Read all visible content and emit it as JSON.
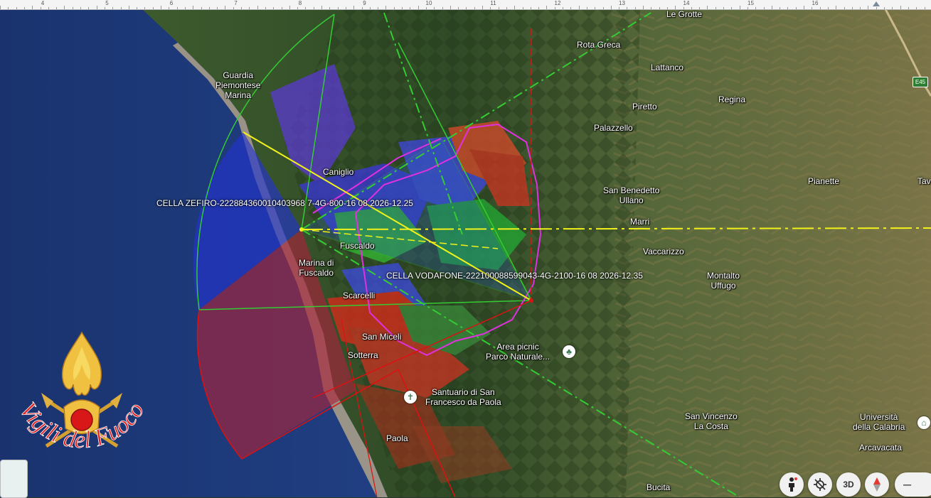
{
  "ruler": {
    "numbers": [
      "4",
      "5",
      "6",
      "7",
      "8",
      "9",
      "10",
      "11",
      "12",
      "13",
      "14",
      "15",
      "16"
    ]
  },
  "cells": {
    "zefiro": "CELLA ZEFIRO-222884360010403968 7-4G-800-16 08 2026-12.25",
    "vodafone": "CELLA VODAFONE-222100088599043-4G-2100-16 08 2026-12.35"
  },
  "places": {
    "le_grotte": "Le Grotte",
    "rota_greca": "Rota Greca",
    "lattanco": "Lattanco",
    "regina": "Regina",
    "guardia": "Guardia\nPiemontese\nMarina",
    "piretto": "Piretto",
    "palazzello": "Palazzello",
    "caniglio": "Caniglio",
    "san_benedetto": "San Benedetto\nUllano",
    "pianette": "Pianette",
    "tav": "Tav",
    "marri": "Marri",
    "fuscaldo": "Fuscaldo",
    "marina_fuscaldo": "Marina di\nFuscaldo",
    "vaccarizzo": "Vaccarizzo",
    "montalto": "Montalto\nUffugo",
    "scarcelli": "Scarcelli",
    "san_miceli": "San Miceli",
    "sotterra": "Sotterra",
    "area_picnic": "Area picnic\nParco Naturale...",
    "santuario": "Santuario di San\nFrancesco da Paola",
    "san_vincenzo": "San Vincenzo\nLa Costa",
    "universita": "Università\ndella Calabria",
    "paola": "Paola",
    "arcavacata": "Arcavacata",
    "bucita": "Bucita"
  },
  "road_badge": "E45",
  "emblem_text": "Vigili del Fuoco",
  "controls": {
    "three_d": "3D",
    "zoom_out": "–"
  },
  "colors": {
    "sea": "#1f3f8a",
    "sector_blue": "#2233cc",
    "sector_red": "#a8243a",
    "line_green": "#33cc33",
    "line_yellow": "#f2f21a",
    "line_red": "#dd1111",
    "coverage_magenta": "#e030e0",
    "emblem_red": "#e02020"
  }
}
